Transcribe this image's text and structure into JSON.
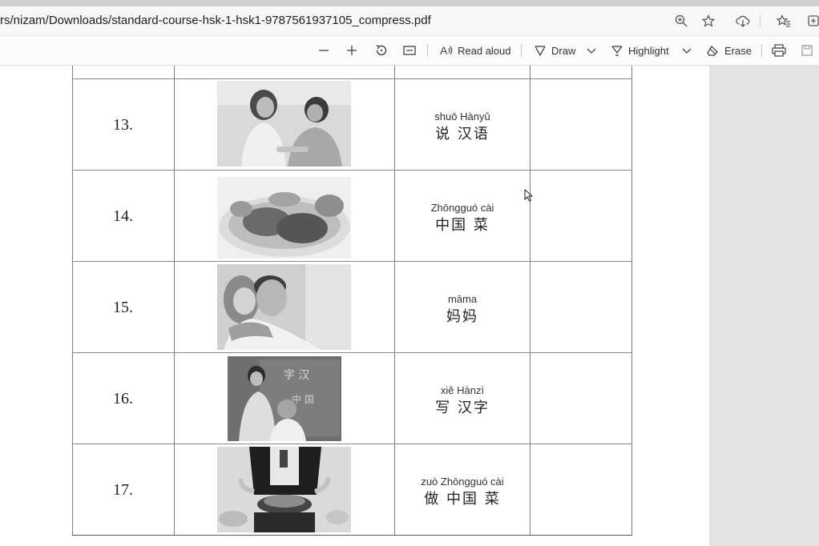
{
  "address_bar": {
    "url": "rs/nizam/Downloads/standard-course-hsk-1-hsk1-9787561937105_compress.pdf",
    "icons": [
      "zoom-icon",
      "favorite-star-icon",
      "download-cloud-icon",
      "favorites-list-icon",
      "collections-icon"
    ]
  },
  "pdf_toolbar": {
    "zoom_out_icon": "minus-icon",
    "zoom_in_icon": "plus-icon",
    "rotate_icon": "rotate-icon",
    "fit_icon": "fit-width-icon",
    "read_aloud": "Read aloud",
    "draw": "Draw",
    "highlight": "Highlight",
    "erase": "Erase",
    "print_icon": "print-icon",
    "save_icon": "save-icon"
  },
  "rows": [
    {
      "number": "13.",
      "pinyin": "shuō Hànyǔ",
      "hanzi": "说 汉语",
      "image": "two women talking"
    },
    {
      "number": "14.",
      "pinyin": "Zhōngguó cài",
      "hanzi": "中国  菜",
      "image": "plate of chinese food"
    },
    {
      "number": "15.",
      "pinyin": "māma",
      "hanzi": "妈妈",
      "image": "father hugging daughter"
    },
    {
      "number": "16.",
      "pinyin": "xiě Hànzì",
      "hanzi": "写 汉字",
      "image": "boys writing on chalkboard"
    },
    {
      "number": "17.",
      "pinyin": "zuò Zhōngguó cài",
      "hanzi": "做  中国  菜",
      "image": "chef cooking in wok"
    }
  ]
}
